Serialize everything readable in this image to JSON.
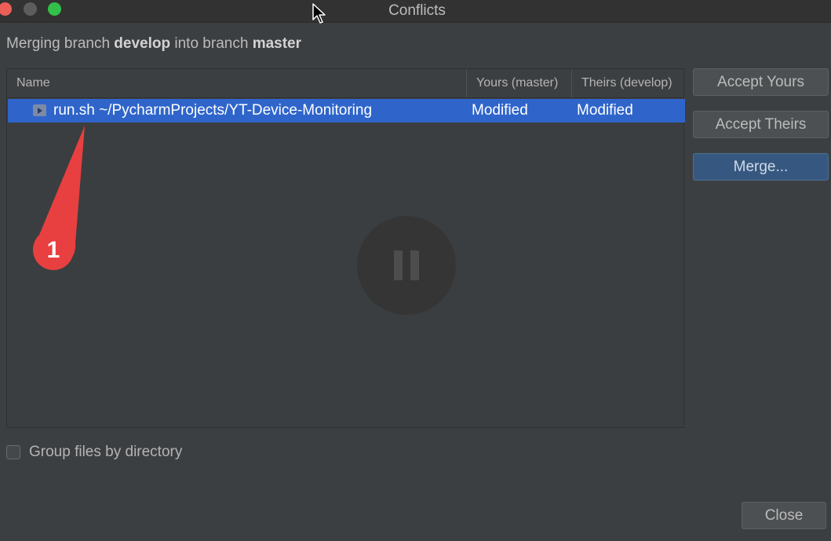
{
  "window": {
    "title": "Conflicts"
  },
  "header": {
    "prefix": "Merging branch ",
    "source_branch": "develop",
    "middle": " into branch ",
    "target_branch": "master"
  },
  "table": {
    "columns": [
      "Name",
      "Yours (master)",
      "Theirs (develop)"
    ],
    "rows": [
      {
        "file": "run.sh  ~/PycharmProjects/YT-Device-Monitoring",
        "yours": "Modified",
        "theirs": "Modified",
        "icon": "shell-script-icon",
        "selected": true
      }
    ]
  },
  "buttons": {
    "accept_yours": "Accept Yours",
    "accept_theirs": "Accept Theirs",
    "merge": "Merge...",
    "close": "Close"
  },
  "options": {
    "group_files_label": "Group files by directory",
    "group_files_checked": false
  },
  "annotation": {
    "number": "1",
    "color": "#e84040"
  },
  "colors": {
    "selection": "#2f65ca",
    "default_button": "#365880",
    "background": "#3c3f41"
  }
}
